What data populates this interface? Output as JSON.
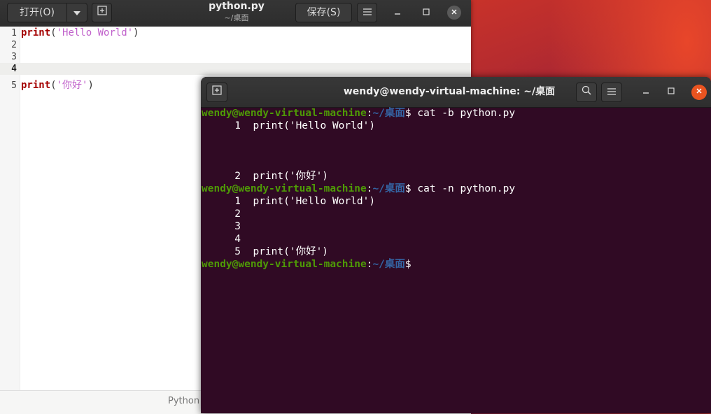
{
  "gedit": {
    "open_label": "打开(O)",
    "title": "python.py",
    "subtitle": "~/桌面",
    "save_label": "保存(S)",
    "lines": [
      {
        "num": "1",
        "fn": "print",
        "open": "(",
        "str": "'Hello World'",
        "close": ")"
      },
      {
        "num": "2"
      },
      {
        "num": "3"
      },
      {
        "num": "4"
      },
      {
        "num": "5",
        "fn": "print",
        "open": "(",
        "str": "'你好'",
        "close": ")"
      }
    ],
    "status_language": "Python"
  },
  "terminal": {
    "title": "wendy@wendy-virtual-machine: ~/桌面",
    "prompt_user": "wendy@wendy-virtual-machine",
    "prompt_colon": ":",
    "prompt_path": "~/桌面",
    "prompt_dollar": "$",
    "commands": [
      {
        "cmd": " cat -b python.py",
        "output": [
          {
            "n": "1",
            "text": "  print('Hello World')"
          },
          {
            "n": "",
            "text": ""
          },
          {
            "n": "",
            "text": ""
          },
          {
            "n": "",
            "text": ""
          },
          {
            "n": "2",
            "text": "  print('你好')"
          }
        ]
      },
      {
        "cmd": " cat -n python.py",
        "output": [
          {
            "n": "1",
            "text": "  print('Hello World')"
          },
          {
            "n": "2",
            "text": ""
          },
          {
            "n": "3",
            "text": ""
          },
          {
            "n": "4",
            "text": ""
          },
          {
            "n": "5",
            "text": "  print('你好')"
          }
        ]
      }
    ]
  },
  "colors": {
    "terminal_bg": "#300a24",
    "prompt_user": "#4e9a06",
    "prompt_path": "#3465a4",
    "close_button": "#e95420"
  }
}
